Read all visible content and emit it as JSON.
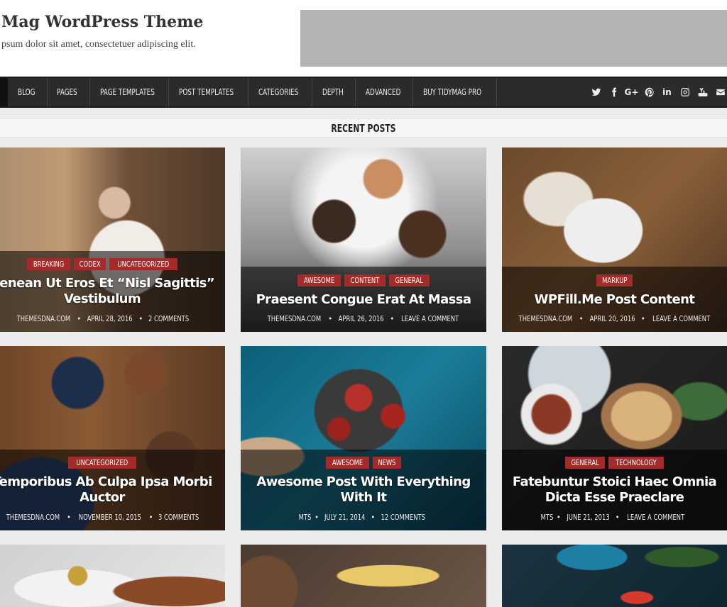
{
  "header": {
    "title": "Mag WordPress Theme",
    "tagline": "psum dolor sit amet, consectetuer adipiscing elit."
  },
  "nav": {
    "items": [
      {
        "label": "BLOG"
      },
      {
        "label": "PAGES"
      },
      {
        "label": "PAGE TEMPLATES"
      },
      {
        "label": "POST TEMPLATES"
      },
      {
        "label": "CATEGORIES"
      },
      {
        "label": "DEPTH"
      },
      {
        "label": "ADVANCED"
      },
      {
        "label": "BUY TIDYMAG PRO"
      }
    ],
    "social": [
      "twitter-icon",
      "facebook-icon",
      "google-plus-icon",
      "pinterest-icon",
      "linkedin-icon",
      "instagram-icon",
      "youtube-icon",
      "email-icon"
    ],
    "google_plus_text": "G+",
    "linkedin_text": "in"
  },
  "section": {
    "title": "RECENT POSTS"
  },
  "colors": {
    "accent": "#a52a2a",
    "nav_bg": "#2b2b2b"
  },
  "posts": [
    {
      "cats": [
        "BREAKING",
        "CODEX",
        "UNCATEGORIZED"
      ],
      "title": "Aenean Ut Eros Et “Nisl Sagittis” Vestibulum",
      "author": "THEMESDNA.COM",
      "date": "APRIL 28, 2016",
      "comments": "2 COMMENTS"
    },
    {
      "cats": [
        "AWESOME",
        "CONTENT",
        "GENERAL"
      ],
      "title": "Praesent Congue Erat At Massa",
      "author": "THEMESDNA.COM",
      "date": "APRIL 26, 2016",
      "comments": "LEAVE A COMMENT"
    },
    {
      "cats": [
        "MARKUP"
      ],
      "title": "WPFill.Me Post Content",
      "author": "THEMESDNA.COM",
      "date": "APRIL 20, 2016",
      "comments": "LEAVE A COMMENT"
    },
    {
      "cats": [
        "UNCATEGORIZED"
      ],
      "title": "Temporibus Ab Culpa Ipsa Morbi Auctor",
      "author": "THEMESDNA.COM",
      "date": "NOVEMBER 10, 2015",
      "comments": "3 COMMENTS"
    },
    {
      "cats": [
        "AWESOME",
        "NEWS"
      ],
      "title": "Awesome Post With Everything With It",
      "author": "MTS",
      "date": "JULY 21, 2014",
      "comments": "12 COMMENTS"
    },
    {
      "cats": [
        "GENERAL",
        "TECHNOLOGY"
      ],
      "title": "Fatebuntur Stoici Haec Omnia Dicta Esse Praeclare",
      "author": "MTS",
      "date": "JUNE 21, 2013",
      "comments": "LEAVE A COMMENT"
    }
  ],
  "meta_separator": "•"
}
